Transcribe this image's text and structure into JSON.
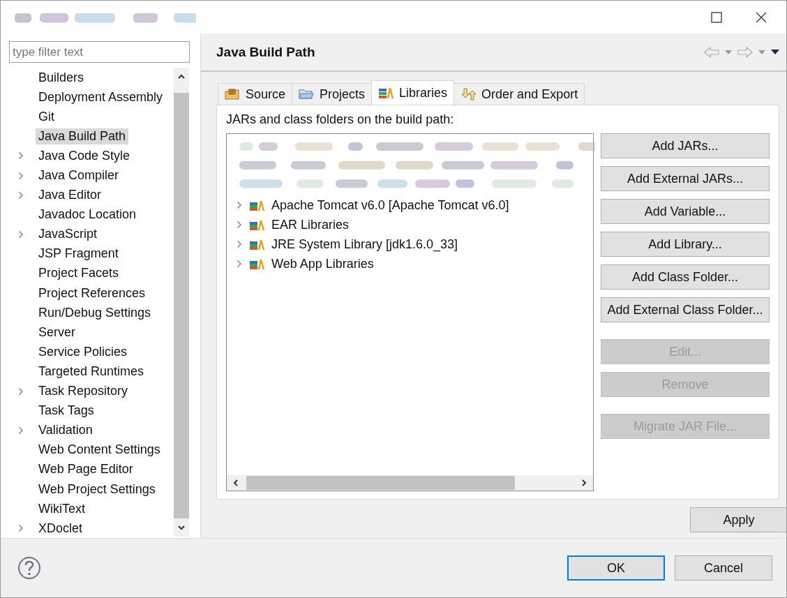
{
  "sidebar": {
    "filter": {
      "placeholder": "type filter text"
    },
    "items": [
      {
        "label": "Builders",
        "expandable": false,
        "selected": false
      },
      {
        "label": "Deployment Assembly",
        "expandable": false,
        "selected": false
      },
      {
        "label": "Git",
        "expandable": false,
        "selected": false
      },
      {
        "label": "Java Build Path",
        "expandable": false,
        "selected": true
      },
      {
        "label": "Java Code Style",
        "expandable": true,
        "selected": false
      },
      {
        "label": "Java Compiler",
        "expandable": true,
        "selected": false
      },
      {
        "label": "Java Editor",
        "expandable": true,
        "selected": false
      },
      {
        "label": "Javadoc Location",
        "expandable": false,
        "selected": false
      },
      {
        "label": "JavaScript",
        "expandable": true,
        "selected": false
      },
      {
        "label": "JSP Fragment",
        "expandable": false,
        "selected": false
      },
      {
        "label": "Project Facets",
        "expandable": false,
        "selected": false
      },
      {
        "label": "Project References",
        "expandable": false,
        "selected": false
      },
      {
        "label": "Run/Debug Settings",
        "expandable": false,
        "selected": false
      },
      {
        "label": "Server",
        "expandable": false,
        "selected": false
      },
      {
        "label": "Service Policies",
        "expandable": false,
        "selected": false
      },
      {
        "label": "Targeted Runtimes",
        "expandable": false,
        "selected": false
      },
      {
        "label": "Task Repository",
        "expandable": true,
        "selected": false
      },
      {
        "label": "Task Tags",
        "expandable": false,
        "selected": false
      },
      {
        "label": "Validation",
        "expandable": true,
        "selected": false
      },
      {
        "label": "Web Content Settings",
        "expandable": false,
        "selected": false
      },
      {
        "label": "Web Page Editor",
        "expandable": false,
        "selected": false
      },
      {
        "label": "Web Project Settings",
        "expandable": false,
        "selected": false
      },
      {
        "label": "WikiText",
        "expandable": false,
        "selected": false
      },
      {
        "label": "XDoclet",
        "expandable": true,
        "selected": false
      }
    ]
  },
  "page": {
    "title": "Java Build Path",
    "tabs": [
      {
        "label": "Source",
        "selected": false
      },
      {
        "label": "Projects",
        "selected": false
      },
      {
        "label": "Libraries",
        "selected": true
      },
      {
        "label": "Order and Export",
        "selected": false
      }
    ],
    "list_label": "JARs and class folders on the build path:",
    "entries": [
      {
        "label": "Apache Tomcat v6.0 [Apache Tomcat v6.0]",
        "expanded": false
      },
      {
        "label": "EAR Libraries",
        "expanded": false
      },
      {
        "label": "JRE System Library [jdk1.6.0_33]",
        "expanded": false
      },
      {
        "label": "Web App Libraries",
        "expanded": false
      }
    ],
    "button_groups": [
      [
        {
          "label": "Add JARs...",
          "disabled": false
        },
        {
          "label": "Add External JARs...",
          "disabled": false
        },
        {
          "label": "Add Variable...",
          "disabled": false
        },
        {
          "label": "Add Library...",
          "disabled": false
        },
        {
          "label": "Add Class Folder...",
          "disabled": false
        },
        {
          "label": "Add External Class Folder...",
          "disabled": false
        }
      ],
      [
        {
          "label": "Edit...",
          "disabled": true
        },
        {
          "label": "Remove",
          "disabled": true
        }
      ],
      [
        {
          "label": "Migrate JAR File...",
          "disabled": true
        }
      ]
    ],
    "apply": "Apply"
  },
  "footer": {
    "buttons": [
      {
        "label": "OK",
        "default": true
      },
      {
        "label": "Cancel",
        "default": false
      }
    ]
  }
}
